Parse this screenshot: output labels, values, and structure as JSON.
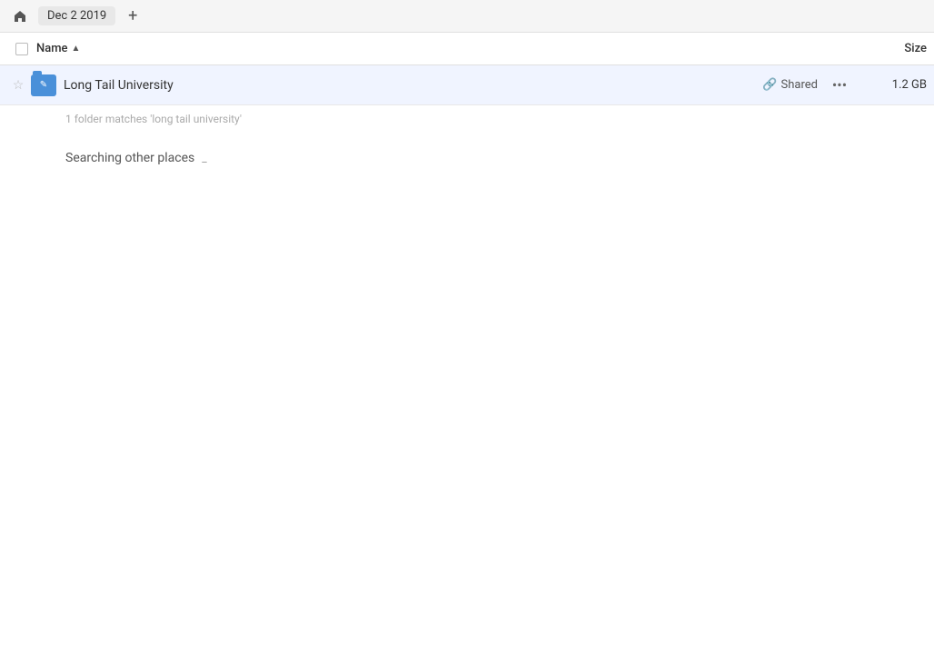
{
  "topbar": {
    "home_icon": "⌂",
    "breadcrumb_label": "Dec 2 2019",
    "add_tab_icon": "+"
  },
  "columns": {
    "name_label": "Name",
    "sort_icon": "▲",
    "size_label": "Size"
  },
  "file_row": {
    "star_icon": "☆",
    "folder_pen_icon": "✎",
    "name": "Long Tail University",
    "shared_label": "Shared",
    "link_icon": "🔗",
    "more_icon": "···",
    "size": "1.2 GB"
  },
  "match_info": "1 folder matches 'long tail university'",
  "searching": {
    "label": "Searching other places",
    "spinner": "_"
  }
}
